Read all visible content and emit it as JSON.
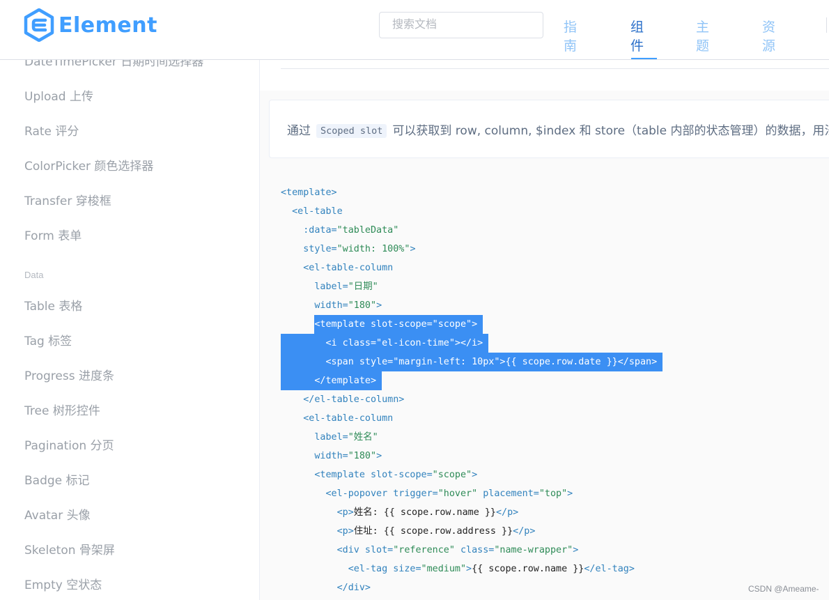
{
  "header": {
    "logo_text": "Element",
    "search_placeholder": "搜索文档",
    "nav": [
      "指南",
      "组件",
      "主题",
      "资源"
    ],
    "active_nav": "组件"
  },
  "sidebar": {
    "top_partial": "DateTimePicker 日期时间选择器",
    "items_a": [
      "Upload 上传",
      "Rate 评分",
      "ColorPicker 颜色选择器",
      "Transfer 穿梭框",
      "Form 表单"
    ],
    "group": "Data",
    "items_b": [
      "Table 表格",
      "Tag 标签",
      "Progress 进度条",
      "Tree 树形控件",
      "Pagination 分页",
      "Badge 标记",
      "Avatar 头像",
      "Skeleton 骨架屏",
      "Empty 空状态"
    ]
  },
  "description": {
    "before": "通过",
    "chip": "Scoped slot",
    "after": "可以获取到 row, column, $index 和 store（table 内部的状态管理）的数据，用法"
  },
  "code_lines": [
    "<template>",
    "  <el-table",
    "    :data=\"tableData\"",
    "    style=\"width: 100%\">",
    "    <el-table-column",
    "      label=\"日期\"",
    "      width=\"180\">",
    "      <template slot-scope=\"scope\">",
    "        <i class=\"el-icon-time\"></i>",
    "        <span style=\"margin-left: 10px\">{{ scope.row.date }}</span>",
    "      </template>",
    "    </el-table-column>",
    "    <el-table-column",
    "      label=\"姓名\"",
    "      width=\"180\">",
    "      <template slot-scope=\"scope\">",
    "        <el-popover trigger=\"hover\" placement=\"top\">",
    "          <p>姓名: {{ scope.row.name }}</p>",
    "          <p>住址: {{ scope.row.address }}</p>",
    "          <div slot=\"reference\" class=\"name-wrapper\">",
    "            <el-tag size=\"medium\">{{ scope.row.name }}</el-tag>",
    "          </div>"
  ],
  "selected_lines": [
    7,
    8,
    9,
    10
  ],
  "watermark": "CSDN @Ameame-",
  "colors": {
    "brand": "#409eff",
    "selection": "#3b8ff3",
    "nav_active": "#2a6fc9"
  }
}
